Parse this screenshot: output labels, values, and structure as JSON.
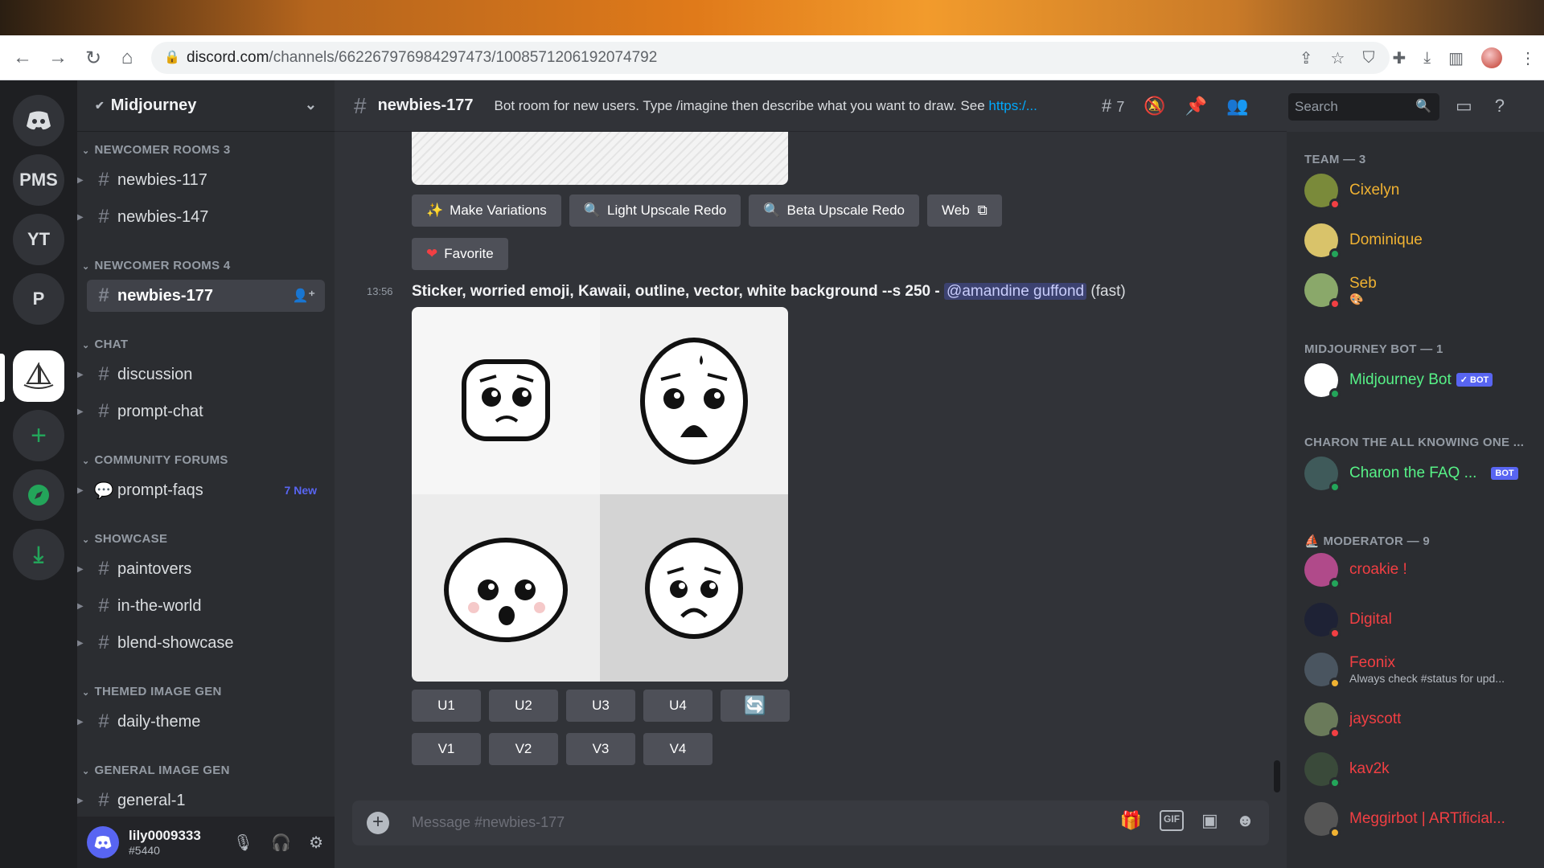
{
  "browser": {
    "url_host": "discord.com",
    "url_path": "/channels/662267976984297473/1008571206192074792"
  },
  "guilds": [
    {
      "label": ""
    },
    {
      "label": "PMS"
    },
    {
      "label": "YT"
    },
    {
      "label": "P"
    }
  ],
  "server": {
    "name": "Midjourney",
    "categories": [
      {
        "title": "NEWCOMER ROOMS 3"
      },
      {
        "title": "NEWCOMER ROOMS 4"
      },
      {
        "title": "CHAT"
      },
      {
        "title": "COMMUNITY FORUMS"
      },
      {
        "title": "SHOWCASE"
      },
      {
        "title": "THEMED IMAGE GEN"
      },
      {
        "title": "GENERAL IMAGE GEN"
      }
    ],
    "channels": [
      {
        "name": "newbies-117"
      },
      {
        "name": "newbies-147"
      },
      {
        "name": "newbies-177"
      },
      {
        "name": "discussion"
      },
      {
        "name": "prompt-chat"
      },
      {
        "name": "prompt-faqs",
        "badge": "7 New"
      },
      {
        "name": "paintovers"
      },
      {
        "name": "in-the-world"
      },
      {
        "name": "blend-showcase"
      },
      {
        "name": "daily-theme"
      },
      {
        "name": "general-1"
      }
    ]
  },
  "user": {
    "name": "lily0009333",
    "tag": "#5440"
  },
  "channel_header": {
    "name": "newbies-177",
    "topic": "Bot room for new users. Type /imagine then describe what you want to draw. See ",
    "topic_link": "https:/...",
    "threads_count": "7",
    "search_placeholder": "Search"
  },
  "prev_message": {
    "buttons": [
      {
        "label": "Make Variations",
        "icon": "sparkle-icon"
      },
      {
        "label": "Light Upscale Redo",
        "icon": "magnifier-icon"
      },
      {
        "label": "Beta Upscale Redo",
        "icon": "magnifier-icon"
      },
      {
        "label": "Web",
        "icon": "external-link-icon"
      }
    ],
    "favorite": "Favorite"
  },
  "message": {
    "time": "13:56",
    "prompt": "Sticker, worried emoji, Kawaii, outline, vector, white background --s 250",
    "separator": " - ",
    "mention": "@amandine guffond",
    "mode": "(fast)",
    "upscale_buttons": [
      "U1",
      "U2",
      "U3",
      "U4"
    ],
    "variation_buttons": [
      "V1",
      "V2",
      "V3",
      "V4"
    ]
  },
  "composer": {
    "placeholder": "Message #newbies-177"
  },
  "members": {
    "groups": [
      {
        "title": "TEAM — 3"
      },
      {
        "title": "MIDJOURNEY BOT — 1"
      },
      {
        "title": "CHARON THE ALL KNOWING ONE ..."
      },
      {
        "title": "MODERATOR — 9"
      }
    ],
    "list": [
      {
        "name": "Cixelyn",
        "color": "#f0b232",
        "status": "#f23f43"
      },
      {
        "name": "Dominique",
        "color": "#f0b232",
        "status": "#23a55a"
      },
      {
        "name": "Seb",
        "color": "#f0b232",
        "status": "#f23f43"
      },
      {
        "name": "Midjourney Bot",
        "color": "#57f287",
        "status": "#23a55a",
        "badge": "✓ BOT"
      },
      {
        "name": "Charon the FAQ ...",
        "color": "#57f287",
        "status": "#23a55a",
        "badge": "BOT"
      },
      {
        "name": "croakie !",
        "color": "#f23f43",
        "status": "#23a55a"
      },
      {
        "name": "Digital",
        "color": "#f23f43",
        "status": "#f23f43"
      },
      {
        "name": "Feonix",
        "color": "#f23f43",
        "status": "#f0b232",
        "sub": "Always check #status for upd..."
      },
      {
        "name": "jayscott",
        "color": "#f23f43",
        "status": "#f23f43"
      },
      {
        "name": "kav2k",
        "color": "#f23f43",
        "status": "#23a55a"
      },
      {
        "name": "Meggirbot | ARTificial...",
        "color": "#f23f43",
        "status": "#f0b232"
      }
    ]
  }
}
